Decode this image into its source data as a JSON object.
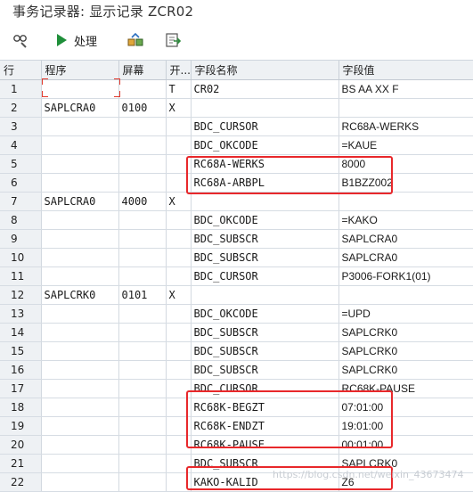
{
  "window": {
    "title": "事务记录器: 显示记录 ZCR02"
  },
  "toolbar": {
    "tools_icon": "glasses-wrench-icon",
    "process_label": "处理",
    "process_icon": "play-icon",
    "transfer_icon": "transport-icon",
    "export_icon": "export-icon"
  },
  "columns": [
    "行",
    "程序",
    "屏幕",
    "开...",
    "字段名称",
    "字段值"
  ],
  "rows": [
    {
      "n": "1",
      "program": "",
      "screen": "",
      "start": "T",
      "field": "CR02",
      "value": "BS AA XX  F"
    },
    {
      "n": "2",
      "program": "SAPLCRA0",
      "screen": "0100",
      "start": "X",
      "field": "",
      "value": ""
    },
    {
      "n": "3",
      "program": "",
      "screen": "",
      "start": "",
      "field": "BDC_CURSOR",
      "value": "RC68A-WERKS"
    },
    {
      "n": "4",
      "program": "",
      "screen": "",
      "start": "",
      "field": "BDC_OKCODE",
      "value": "=KAUE"
    },
    {
      "n": "5",
      "program": "",
      "screen": "",
      "start": "",
      "field": "RC68A-WERKS",
      "value": "8000"
    },
    {
      "n": "6",
      "program": "",
      "screen": "",
      "start": "",
      "field": "RC68A-ARBPL",
      "value": "B1BZZ002"
    },
    {
      "n": "7",
      "program": "SAPLCRA0",
      "screen": "4000",
      "start": "X",
      "field": "",
      "value": ""
    },
    {
      "n": "8",
      "program": "",
      "screen": "",
      "start": "",
      "field": "BDC_OKCODE",
      "value": "=KAKO"
    },
    {
      "n": "9",
      "program": "",
      "screen": "",
      "start": "",
      "field": "BDC_SUBSCR",
      "value": "SAPLCRA0"
    },
    {
      "n": "10",
      "program": "",
      "screen": "",
      "start": "",
      "field": "BDC_SUBSCR",
      "value": "SAPLCRA0"
    },
    {
      "n": "11",
      "program": "",
      "screen": "",
      "start": "",
      "field": "BDC_CURSOR",
      "value": "P3006-FORK1(01)"
    },
    {
      "n": "12",
      "program": "SAPLCRK0",
      "screen": "0101",
      "start": "X",
      "field": "",
      "value": ""
    },
    {
      "n": "13",
      "program": "",
      "screen": "",
      "start": "",
      "field": "BDC_OKCODE",
      "value": "=UPD"
    },
    {
      "n": "14",
      "program": "",
      "screen": "",
      "start": "",
      "field": "BDC_SUBSCR",
      "value": "SAPLCRK0"
    },
    {
      "n": "15",
      "program": "",
      "screen": "",
      "start": "",
      "field": "BDC_SUBSCR",
      "value": "SAPLCRK0"
    },
    {
      "n": "16",
      "program": "",
      "screen": "",
      "start": "",
      "field": "BDC_SUBSCR",
      "value": "SAPLCRK0"
    },
    {
      "n": "17",
      "program": "",
      "screen": "",
      "start": "",
      "field": "BDC_CURSOR",
      "value": "RC68K-PAUSE"
    },
    {
      "n": "18",
      "program": "",
      "screen": "",
      "start": "",
      "field": "RC68K-BEGZT",
      "value": "07:01:00"
    },
    {
      "n": "19",
      "program": "",
      "screen": "",
      "start": "",
      "field": "RC68K-ENDZT",
      "value": "19:01:00"
    },
    {
      "n": "20",
      "program": "",
      "screen": "",
      "start": "",
      "field": "RC68K-PAUSE",
      "value": "00:01:00"
    },
    {
      "n": "21",
      "program": "",
      "screen": "",
      "start": "",
      "field": "BDC_SUBSCR",
      "value": "SAPLCRK0"
    },
    {
      "n": "22",
      "program": "",
      "screen": "",
      "start": "",
      "field": "KAKO-KALID",
      "value": "Z6"
    }
  ],
  "watermark": "https://blog.csdn.net/weixin_43673474",
  "colors": {
    "highlight": "#e8282b",
    "header_bg": "#eef1f4",
    "grid_line": "#d6dce3"
  }
}
